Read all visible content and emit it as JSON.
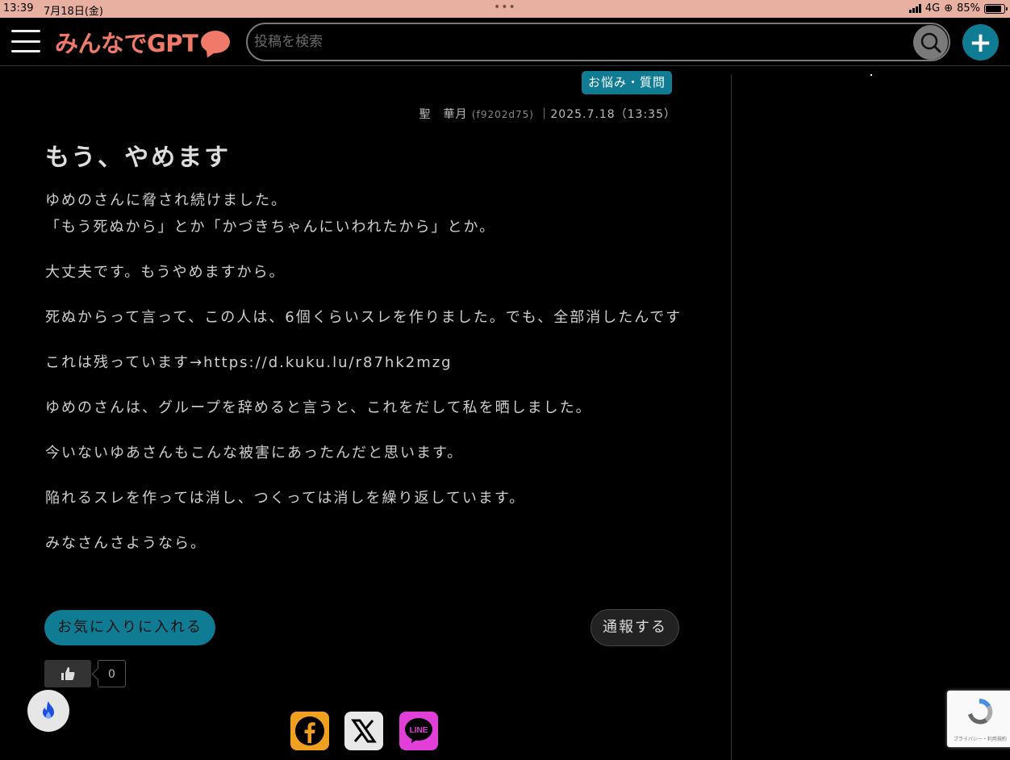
{
  "status_bar": {
    "time": "13:39",
    "date": "7月18日(金)",
    "network": "4G",
    "battery": "85%",
    "battery_level": 0.85
  },
  "header": {
    "logo_text": "みんなでGPT",
    "search_placeholder": "投稿を検索",
    "accent_color": "#f07a6a",
    "brand_color": "#0f7c93"
  },
  "post": {
    "category": "お悩み・質問",
    "author": "聖　華月",
    "author_id": "(f9202d75)",
    "date": "｜2025.7.18（13:35）",
    "title": "もう、やめます",
    "paragraphs": [
      "ゆめのさんに脅され続けました。\n「もう死ぬから」とか「かづきちゃんにいわれたから」とか。",
      "大丈夫です。もうやめますから。",
      "死ぬからって言って、この人は、6個くらいスレを作りました。でも、全部消したんです",
      "これは残っています→https://d.kuku.lu/r87hk2mzg",
      "ゆめのさんは、グループを辞めると言うと、これをだして私を晒しました。",
      "今いないゆあさんもこんな被害にあったんだと思います。",
      "陥れるスレを作っては消し、つくっては消しを繰り返しています。",
      "みなさんさようなら。"
    ],
    "favorite_label": "お気に入りに入れる",
    "report_label": "通報する",
    "like_count": "0"
  },
  "recaptcha": {
    "footer_text": "プライバシー・利用規約"
  },
  "icons": {
    "menu": "hamburger-icon",
    "search": "search-icon",
    "add": "plus-icon",
    "like": "thumbs-up-icon",
    "floating": "flame-icon",
    "share": [
      "facebook-icon",
      "x-icon",
      "line-icon"
    ]
  }
}
